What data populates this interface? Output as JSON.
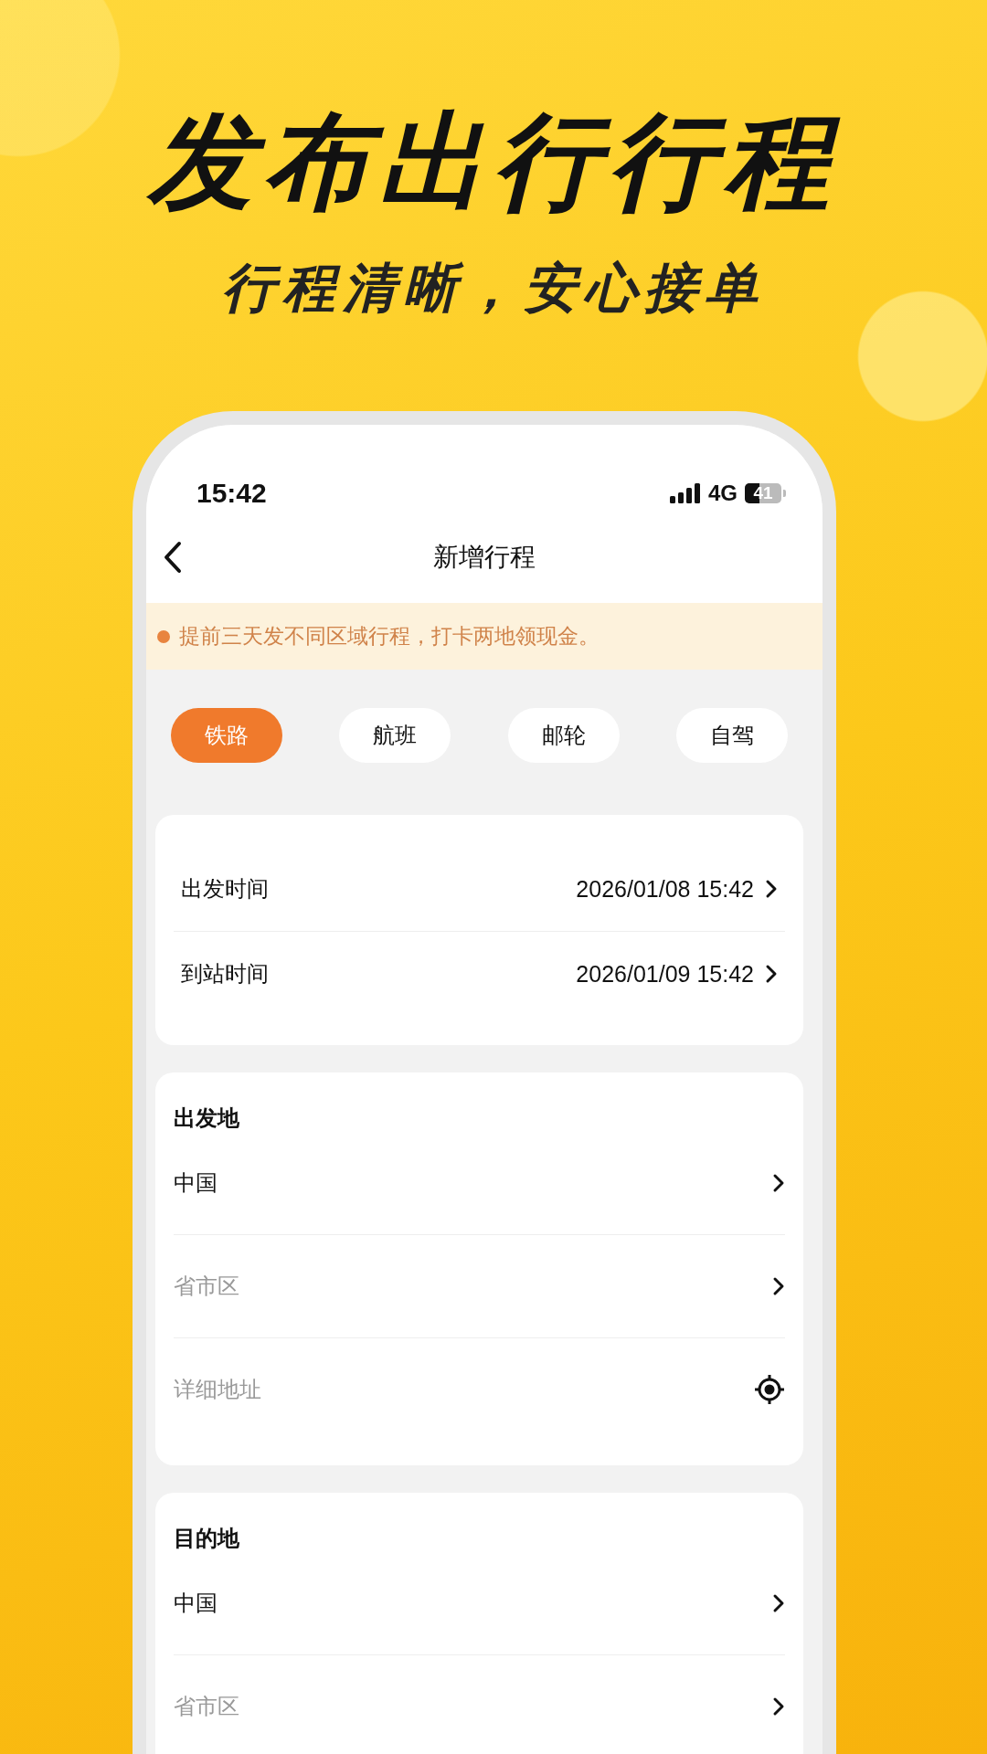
{
  "headline": "发布出行行程",
  "subheadline": "行程清晰，安心接单",
  "status_bar": {
    "time": "15:42",
    "network": "4G",
    "battery": "41"
  },
  "nav": {
    "title": "新增行程"
  },
  "notice": "提前三天发不同区域行程，打卡两地领现金。",
  "transport_tabs": [
    {
      "label": "铁路",
      "selected": true
    },
    {
      "label": "航班",
      "selected": false
    },
    {
      "label": "邮轮",
      "selected": false
    },
    {
      "label": "自驾",
      "selected": false
    }
  ],
  "time_rows": [
    {
      "label": "出发时间",
      "value": "2026/01/08 15:42"
    },
    {
      "label": "到站时间",
      "value": "2026/01/09 15:42"
    }
  ],
  "sections": [
    {
      "title": "出发地",
      "fields": [
        {
          "kind": "select",
          "value": "中国"
        },
        {
          "kind": "select",
          "placeholder": "省市区"
        },
        {
          "kind": "locate",
          "placeholder": "详细地址"
        }
      ]
    },
    {
      "title": "目的地",
      "fields": [
        {
          "kind": "select",
          "value": "中国"
        },
        {
          "kind": "select",
          "placeholder": "省市区"
        }
      ]
    }
  ]
}
